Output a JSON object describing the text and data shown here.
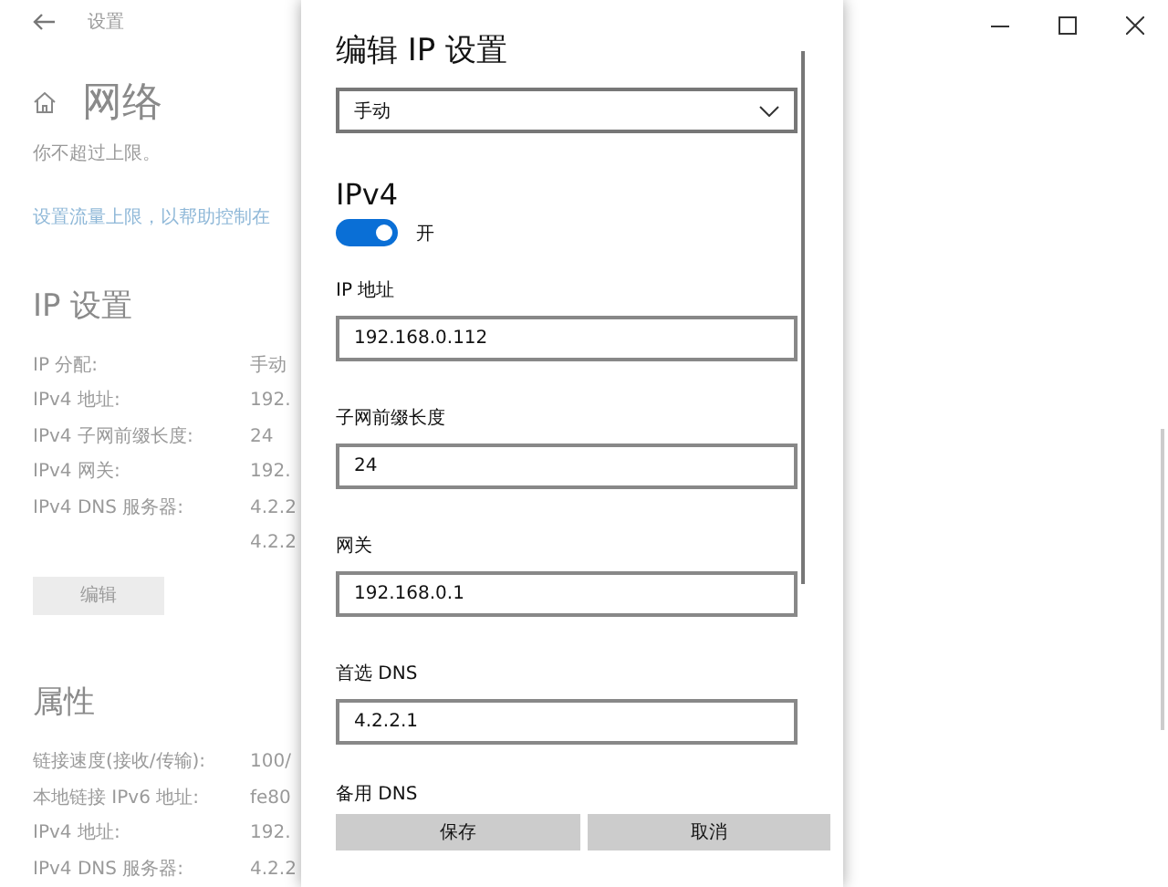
{
  "window": {
    "title": "设置"
  },
  "page": {
    "title": "网络",
    "intro_lines": [
      "你不超过上限。"
    ],
    "link": "设置流量上限，以帮助控制在",
    "ip_settings": {
      "title": "IP 设置",
      "rows": [
        {
          "label": "IP 分配:",
          "values": [
            "手动"
          ]
        },
        {
          "label": "IPv4 地址:",
          "values": [
            "192."
          ]
        },
        {
          "label": "IPv4 子网前缀长度:",
          "values": [
            "24"
          ]
        },
        {
          "label": "IPv4 网关:",
          "values": [
            "192."
          ]
        },
        {
          "label": "IPv4 DNS 服务器:",
          "values": [
            "4.2.2",
            "4.2.2"
          ]
        }
      ],
      "edit_button": "编辑"
    },
    "properties": {
      "title": "属性",
      "rows": [
        {
          "label": "链接速度(接收/传输):",
          "values": [
            "100/"
          ]
        },
        {
          "label": "本地链接 IPv6 地址:",
          "values": [
            "fe80"
          ]
        },
        {
          "label": "IPv4 地址:",
          "values": [
            "192."
          ]
        },
        {
          "label": "IPv4 DNS 服务器:",
          "values": [
            "4.2.2"
          ]
        }
      ]
    }
  },
  "dialog": {
    "title": "编辑 IP 设置",
    "mode": "手动",
    "section": "IPv4",
    "toggle": {
      "on": true,
      "label": "开"
    },
    "fields": [
      {
        "label": "IP 地址",
        "value": "192.168.0.112"
      },
      {
        "label": "子网前缀长度",
        "value": "24"
      },
      {
        "label": "网关",
        "value": "192.168.0.1"
      },
      {
        "label": "首选 DNS",
        "value": "4.2.2.1"
      }
    ],
    "next_label": "备用 DNS",
    "buttons": [
      "保存",
      "取消"
    ]
  }
}
